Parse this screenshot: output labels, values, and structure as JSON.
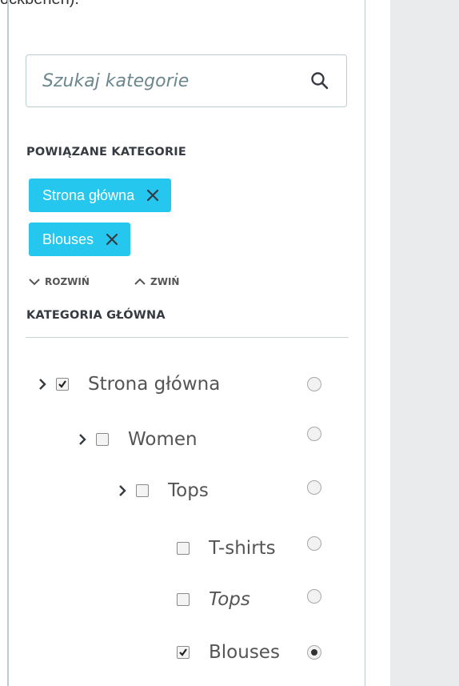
{
  "top_fragment": "ockbehen).",
  "search": {
    "placeholder": "Szukaj kategorie"
  },
  "associated_label": "POWIĄZANE KATEGORIE",
  "tags": [
    {
      "label": "Strona główna"
    },
    {
      "label": "Blouses"
    }
  ],
  "expand_label": "ROZWIŃ",
  "collapse_label": "ZWIŃ",
  "main_category_label": "KATEGORIA GŁÓWNA",
  "tree": [
    {
      "label": "Strona główna",
      "checked": true,
      "expandable": true,
      "default": false
    },
    {
      "label": "Women",
      "checked": false,
      "expandable": true,
      "default": false
    },
    {
      "label": "Tops",
      "checked": false,
      "expandable": true,
      "default": false
    },
    {
      "label": "T-shirts",
      "checked": false,
      "expandable": false,
      "default": false
    },
    {
      "label": "Tops",
      "checked": false,
      "expandable": false,
      "default": false,
      "italic": true
    },
    {
      "label": "Blouses",
      "checked": true,
      "expandable": false,
      "default": true
    }
  ],
  "colors": {
    "tag_bg": "#25c7ef",
    "border": "#bbcdd2",
    "panel_bg": "#eaebec"
  }
}
